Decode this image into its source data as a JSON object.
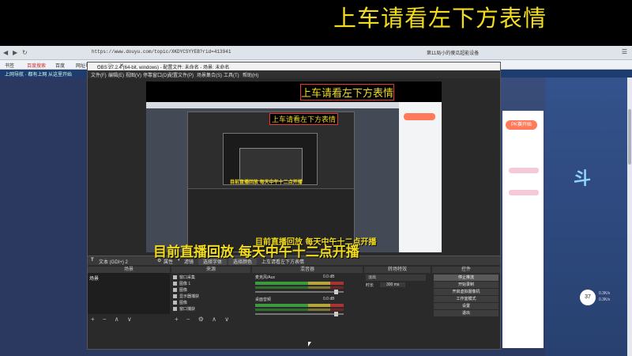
{
  "banner": {
    "title": "上车请看左下方表情"
  },
  "browser": {
    "url": "https://www.douyu.com/topic/XKDYCSYYEB?rid=413941",
    "tab_label": "第11局小的傻瓜超能设备",
    "bookmarks": [
      "书签",
      "百度搜索",
      "百度",
      "网址导航"
    ],
    "site_nav": "上网导航 · 都有上网 从这里开始",
    "right_button": "PK赛开始",
    "score": "37",
    "stats": [
      "0.3K/s",
      "0.3K/s"
    ]
  },
  "obs": {
    "title": "OBS 27.2.4 (64-bit, windows) - 配置文件: 未命名 - 场景: 未命名",
    "menu": [
      "文件(F)",
      "编辑(E)",
      "视图(V)",
      "停靠窗口(D)",
      "配置文件(P)",
      "场景集合(S)",
      "工具(T)",
      "帮助(H)"
    ],
    "preview": {
      "title": "上车请看左下方表情",
      "inner_title": "上车请看左下方表情",
      "inner_caption": "目前直播回放 每天中午十二点开播",
      "caption": "目前直播回放 每天中午十二点开播"
    },
    "source_bar": {
      "type_icon": "T",
      "source_name": "文本 (GDI+) 2",
      "properties": "属性",
      "filters": "滤镜",
      "select_font": "选择字体",
      "select_color": "选择颜色",
      "text_value": "上车请看左下方表情"
    },
    "docks": {
      "scenes_header": "场景",
      "sources_header": "来源",
      "mixer_header": "混音器",
      "transitions_header": "转场特效",
      "controls_header": "控件",
      "scene_items": [
        "场景"
      ],
      "sources": [
        "窗口采集",
        "图像 1",
        "图像",
        "显示器捕获",
        "图像",
        "窗口捕获"
      ],
      "mixer": [
        {
          "name": "麦克风/Aux",
          "level": "0.0 dB"
        },
        {
          "name": "桌面音频",
          "level": "0.0 dB"
        }
      ],
      "transition": {
        "type": "淡出",
        "duration_label": "时长",
        "duration": "300 ms"
      },
      "controls": [
        "停止推流",
        "开始录制",
        "开启虚拟摄像机",
        "工作室模式",
        "设置",
        "退出"
      ]
    },
    "big_caption": "目前直播回放 每天中午十二点开播"
  }
}
